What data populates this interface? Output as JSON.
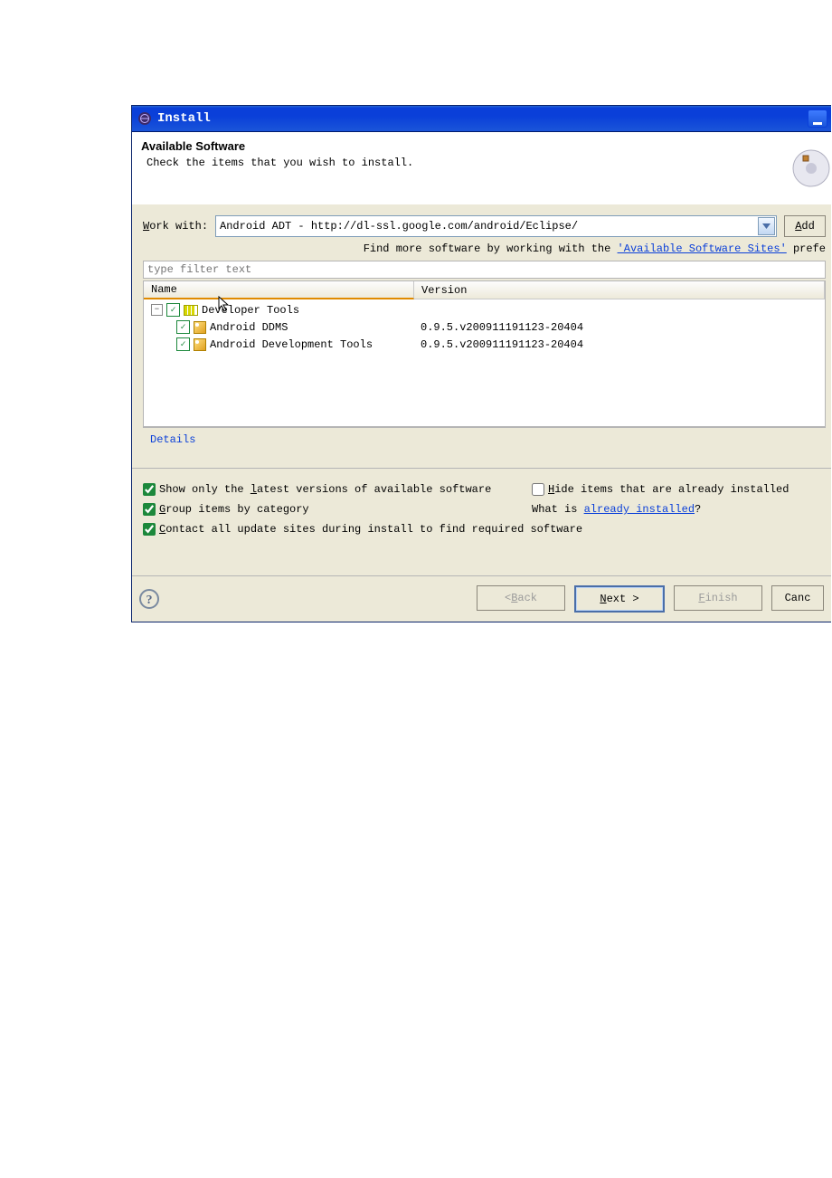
{
  "window": {
    "title": "Install"
  },
  "header": {
    "title": "Available Software",
    "description": "Check the items that you wish to install."
  },
  "workWith": {
    "mnemonic": "W",
    "labelRest": "ork with:",
    "value": "Android ADT - http://dl-ssl.google.com/android/Eclipse/",
    "addMnemonic": "A",
    "addRest": "dd"
  },
  "hint": {
    "prefix": "Find more software by working with the ",
    "link": "'Available Software Sites'",
    "suffix": " prefe"
  },
  "filter": {
    "placeholder": "type filter text"
  },
  "tree": {
    "columns": [
      "Name",
      "Version"
    ],
    "items": [
      {
        "name": "Developer Tools",
        "checked": true,
        "children": [
          {
            "name": "Android DDMS",
            "version": "0.9.5.v200911191123-20404",
            "checked": true
          },
          {
            "name": "Android Development Tools",
            "version": "0.9.5.v200911191123-20404",
            "checked": true
          }
        ]
      }
    ]
  },
  "details": {
    "label": "Details"
  },
  "options": {
    "latest": {
      "pre": "Show only the ",
      "m": "l",
      "post": "atest versions of available software"
    },
    "hide": {
      "m": "H",
      "post": "ide items that are already installed"
    },
    "group": {
      "m": "G",
      "post": "roup items by category"
    },
    "already": {
      "pre": "What is ",
      "link": "already installed",
      "post": "?"
    },
    "contact": {
      "m": "C",
      "post": "ontact all update sites during install to find required software"
    }
  },
  "buttons": {
    "back": {
      "pre": "< ",
      "m": "B",
      "post": "ack"
    },
    "next": {
      "m": "N",
      "post": "ext >"
    },
    "finish": {
      "m": "F",
      "post": "inish"
    },
    "cancel": {
      "label": "Canc"
    }
  }
}
